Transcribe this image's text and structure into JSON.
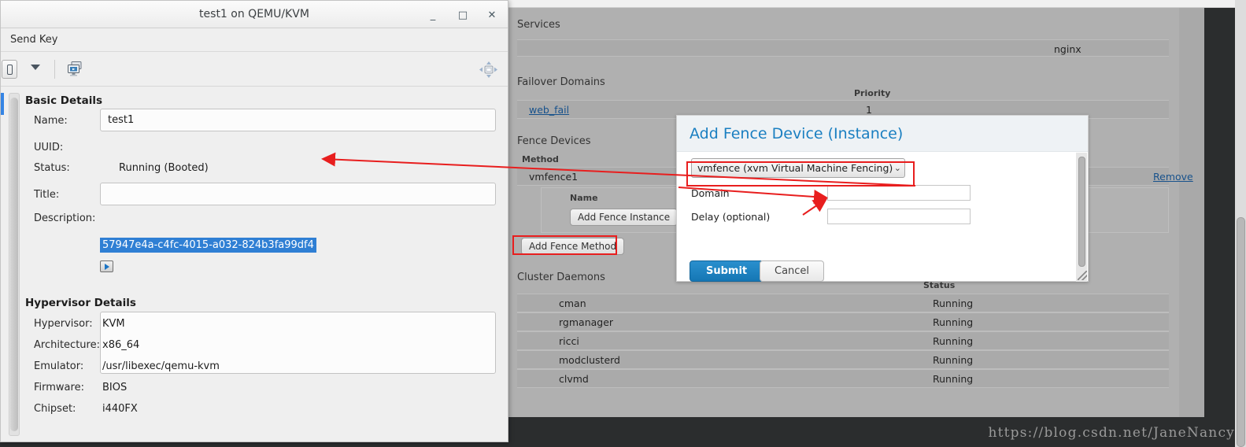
{
  "vm_window": {
    "title": "test1 on QEMU/KVM",
    "window_buttons": {
      "minimize": "_",
      "maximize": "□",
      "close": "✕"
    },
    "menu": {
      "send_key": "Send Key"
    },
    "toolbar": {
      "power_icon": "power-icon",
      "caret_icon": "chevron-down-icon",
      "console_icon": "console-icon",
      "fullscreen_icon": "fullscreen-icon"
    },
    "basic_details": {
      "heading": "Basic Details",
      "name_label": "Name:",
      "name_value": "test1",
      "uuid_label": "UUID:",
      "uuid_value": "57947e4a-c4fc-4015-a032-824b3fa99df4",
      "status_label": "Status:",
      "status_value": "Running (Booted)",
      "status_icon": "running-monitor-icon",
      "title_label": "Title:",
      "title_value": "",
      "description_label": "Description:",
      "description_value": ""
    },
    "hypervisor_details": {
      "heading": "Hypervisor Details",
      "rows": [
        {
          "label": "Hypervisor:",
          "value": "KVM"
        },
        {
          "label": "Architecture:",
          "value": "x86_64"
        },
        {
          "label": "Emulator:",
          "value": "/usr/libexec/qemu-kvm"
        },
        {
          "label": "Firmware:",
          "value": "BIOS"
        },
        {
          "label": "Chipset:",
          "value": "i440FX"
        }
      ]
    }
  },
  "web_page": {
    "services": {
      "label": "Services",
      "rows": [
        {
          "name": "nginx"
        }
      ]
    },
    "failover_domains": {
      "label": "Failover Domains",
      "priority_header": "Priority",
      "rows": [
        {
          "name": "web_fail",
          "priority": "1"
        }
      ]
    },
    "fence_devices": {
      "label": "Fence Devices",
      "method_header": "Method",
      "method_name": "vmfence1",
      "name_header": "Name",
      "remove_link": "Remove",
      "add_fence_instance_button": "Add Fence Instance",
      "add_fence_method_button": "Add Fence Method"
    },
    "cluster_daemons": {
      "label": "Cluster Daemons",
      "status_header": "Status",
      "rows": [
        {
          "name": "cman",
          "status": "Running"
        },
        {
          "name": "rgmanager",
          "status": "Running"
        },
        {
          "name": "ricci",
          "status": "Running"
        },
        {
          "name": "modclusterd",
          "status": "Running"
        },
        {
          "name": "clvmd",
          "status": "Running"
        }
      ]
    }
  },
  "dialog": {
    "title": "Add Fence Device (Instance)",
    "device_select_value": "vmfence (xvm Virtual Machine Fencing)",
    "device_select_chevron": "⌄",
    "domain_label": "Domain",
    "domain_value": "",
    "delay_label": "Delay (optional)",
    "delay_value": "",
    "submit_label": "Submit",
    "cancel_label": "Cancel"
  },
  "watermark": "https://blog.csdn.net/JaneNancy",
  "colors": {
    "accent_blue": "#1a7fc1",
    "submit_blue": "#1577b4",
    "link_blue": "#18528c",
    "selection_blue": "#2f7fd4",
    "highlight_red": "#e81e1e",
    "page_gray": "#b0b0b0",
    "row_gray": "#aaaaaa"
  }
}
